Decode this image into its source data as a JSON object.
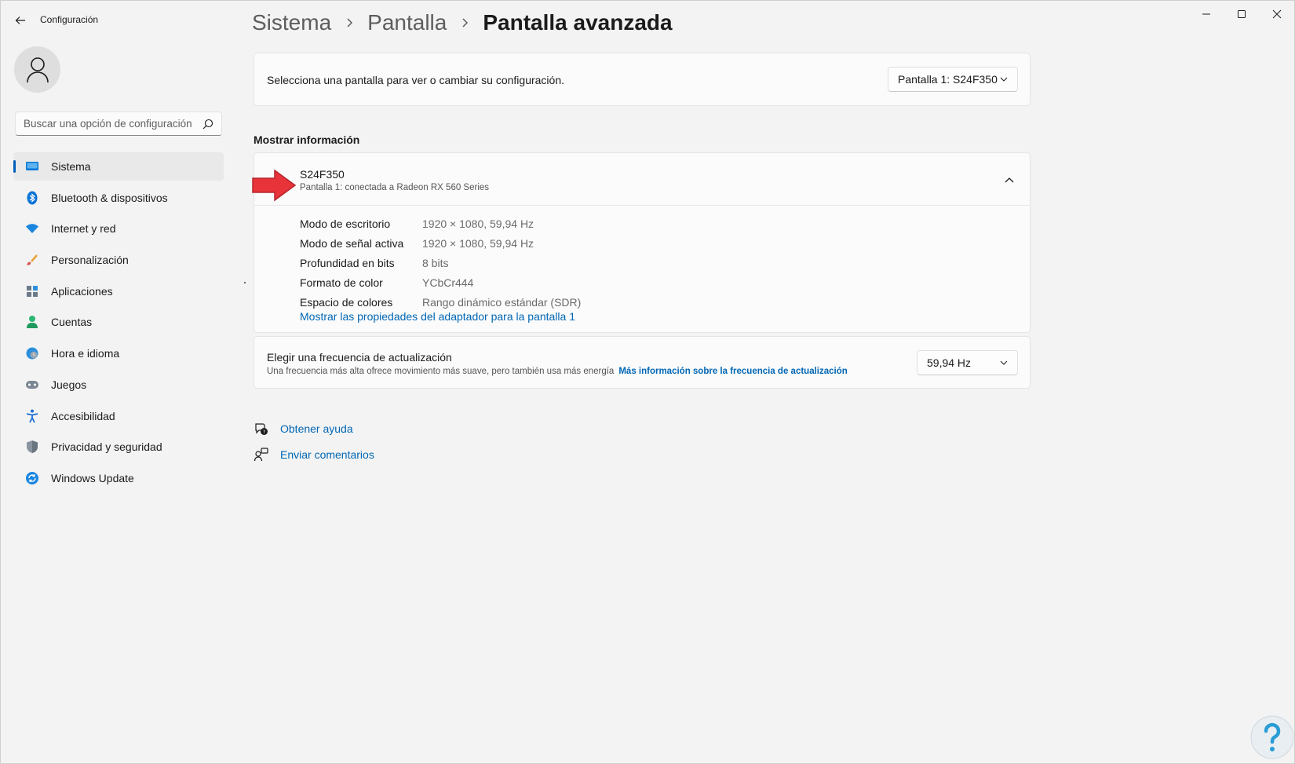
{
  "window": {
    "title": "Configuración",
    "controls": {
      "minimize": "minimize-icon",
      "maximize": "maximize-icon",
      "close": "close-icon"
    }
  },
  "breadcrumb": [
    "Sistema",
    "Pantalla",
    "Pantalla avanzada"
  ],
  "sidebar": {
    "search_placeholder": "Buscar una opción de configuración",
    "items": [
      {
        "label": "Sistema",
        "icon": "monitor-icon",
        "selected": true
      },
      {
        "label": "Bluetooth & dispositivos",
        "icon": "bluetooth-icon"
      },
      {
        "label": "Internet y red",
        "icon": "wifi-icon"
      },
      {
        "label": "Personalización",
        "icon": "brush-icon"
      },
      {
        "label": "Aplicaciones",
        "icon": "apps-icon"
      },
      {
        "label": "Cuentas",
        "icon": "person-icon"
      },
      {
        "label": "Hora e idioma",
        "icon": "globe-clock-icon"
      },
      {
        "label": "Juegos",
        "icon": "gamepad-icon"
      },
      {
        "label": "Accesibilidad",
        "icon": "accessibility-icon"
      },
      {
        "label": "Privacidad y seguridad",
        "icon": "shield-icon"
      },
      {
        "label": "Windows Update",
        "icon": "update-icon"
      }
    ],
    "accent": "#005fb8"
  },
  "display_select": {
    "label": "Selecciona una pantalla para ver o cambiar su configuración.",
    "value": "Pantalla 1: S24F350"
  },
  "info": {
    "section_title": "Mostrar información",
    "name": "S24F350",
    "subtitle": "Pantalla 1: conectada a Radeon RX 560 Series",
    "rows": [
      {
        "key": "Modo de escritorio",
        "value": "1920 × 1080, 59,94 Hz"
      },
      {
        "key": "Modo de señal activa",
        "value": "1920 × 1080, 59,94 Hz"
      },
      {
        "key": "Profundidad en bits",
        "value": "8 bits"
      },
      {
        "key": "Formato de color",
        "value": "YCbCr444"
      },
      {
        "key": "Espacio de colores",
        "value": "Rango dinámico estándar (SDR)"
      }
    ],
    "adapter_link": "Mostrar las propiedades del adaptador para la pantalla 1"
  },
  "refresh": {
    "title": "Elegir una frecuencia de actualización",
    "description": "Una frecuencia más alta ofrece movimiento más suave, pero también usa más energía",
    "link": "Más información sobre la frecuencia de actualización",
    "value": "59,94 Hz"
  },
  "help": {
    "get_help": "Obtener ayuda",
    "feedback": "Enviar comentarios"
  },
  "colors": {
    "link": "#0066b4",
    "arrow": "#e8333a"
  }
}
